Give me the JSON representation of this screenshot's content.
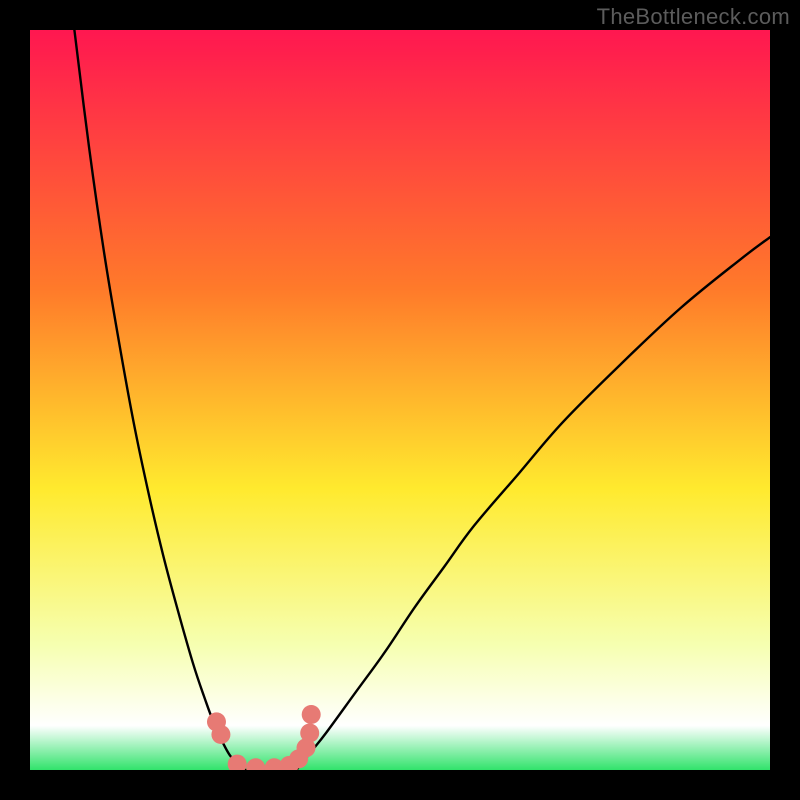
{
  "attribution": "TheBottleneck.com",
  "colors": {
    "frame": "#000000",
    "gradient_top": "#ff1750",
    "gradient_mid1": "#ff7a2a",
    "gradient_mid2": "#ffea2e",
    "gradient_mid3": "#f6ffb0",
    "gradient_low": "#31e36b",
    "curve": "#000000",
    "markers": "#e77a74"
  },
  "chart_data": {
    "type": "line",
    "title": "",
    "xlabel": "",
    "ylabel": "",
    "xlim": [
      0,
      100
    ],
    "ylim": [
      0,
      100
    ],
    "series": [
      {
        "name": "left-branch",
        "x": [
          6,
          8,
          10,
          12,
          14,
          16,
          18,
          20,
          22,
          23.5,
          25,
          27,
          29
        ],
        "values": [
          100,
          84,
          70,
          58,
          47,
          37.5,
          29,
          21.5,
          14.5,
          10,
          6,
          2,
          0
        ]
      },
      {
        "name": "right-branch",
        "x": [
          36,
          38,
          40,
          44,
          48,
          52,
          56,
          60,
          66,
          72,
          80,
          88,
          96,
          100
        ],
        "values": [
          0,
          2.5,
          5,
          10.5,
          16,
          22,
          27.5,
          33,
          40,
          47,
          55,
          62.5,
          69,
          72
        ]
      },
      {
        "name": "valley-floor",
        "x": [
          29,
          30.5,
          32,
          33.5,
          35,
          36
        ],
        "values": [
          0,
          0,
          0,
          0,
          0,
          0
        ]
      }
    ],
    "markers": {
      "x": [
        25.2,
        25.8,
        28.0,
        30.5,
        33.0,
        35.0,
        36.3,
        37.3,
        37.8,
        38.0
      ],
      "y": [
        6.5,
        4.8,
        0.8,
        0.3,
        0.3,
        0.6,
        1.5,
        3.0,
        5.0,
        7.5
      ]
    },
    "annotations": []
  }
}
